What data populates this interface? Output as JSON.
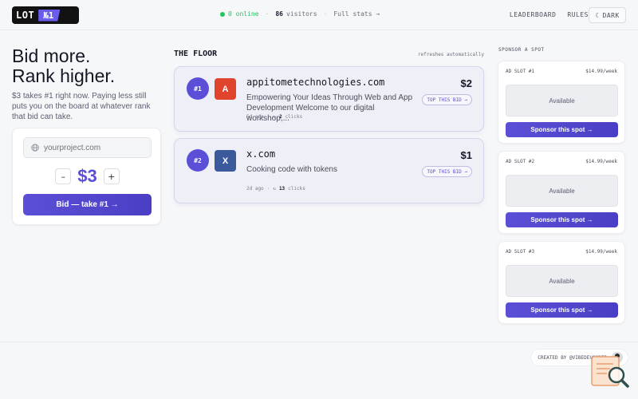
{
  "header": {
    "logo_text": "LOT",
    "logo_badge": "№1",
    "online": "0 online",
    "visitors_count": "86",
    "visitors_label": "visitors",
    "full_stats": "Full stats →",
    "nav": [
      "LEADERBOARD",
      "RULES"
    ],
    "dark_label": "DARK",
    "dark_icon": "☾"
  },
  "hero": {
    "line1": "Bid more.",
    "line2": "Rank higher.",
    "subtitle": "$3 takes #1 right now. Paying less still puts you on the board at whatever rank that bid can take."
  },
  "bid": {
    "placeholder": "yourproject.com",
    "minus": "–",
    "amount": "$3",
    "plus": "+",
    "button": "Bid — take #1 →"
  },
  "floor": {
    "title": "THE FLOOR",
    "refresh": "refreshes automatically",
    "items": [
      {
        "rank": "#1",
        "initial": "A",
        "color": "#e0442c",
        "name": "appitometechnologies.com",
        "description": "Empowering Your Ideas Through Web and App Development Welcome to our digital workshop,...",
        "age": "5d ago",
        "clicks_icon": "↻",
        "clicks": "2",
        "clicks_label": "clicks",
        "price": "$2",
        "button": "TOP THIS BID →"
      },
      {
        "rank": "#2",
        "initial": "X",
        "color": "#3a5a9c",
        "name": "x.com",
        "description": "Cooking code with tokens",
        "age": "2d ago",
        "clicks_icon": "↻",
        "clicks": "13",
        "clicks_label": "clicks",
        "price": "$1",
        "button": "TOP THIS BID →"
      }
    ]
  },
  "sponsor": {
    "title": "SPONSOR A SPOT",
    "slots": [
      {
        "label": "AD SLOT #1",
        "price": "$14.99/week",
        "status": "Available",
        "button": "Sponsor this spot →"
      },
      {
        "label": "AD SLOT #2",
        "price": "$14.99/week",
        "status": "Available",
        "button": "Sponsor this spot →"
      },
      {
        "label": "AD SLOT #3",
        "price": "$14.99/week",
        "status": "Available",
        "button": "Sponsor this spot →"
      }
    ]
  },
  "footer": {
    "created_by": "CREATED BY @VIBEDEVCODER"
  }
}
